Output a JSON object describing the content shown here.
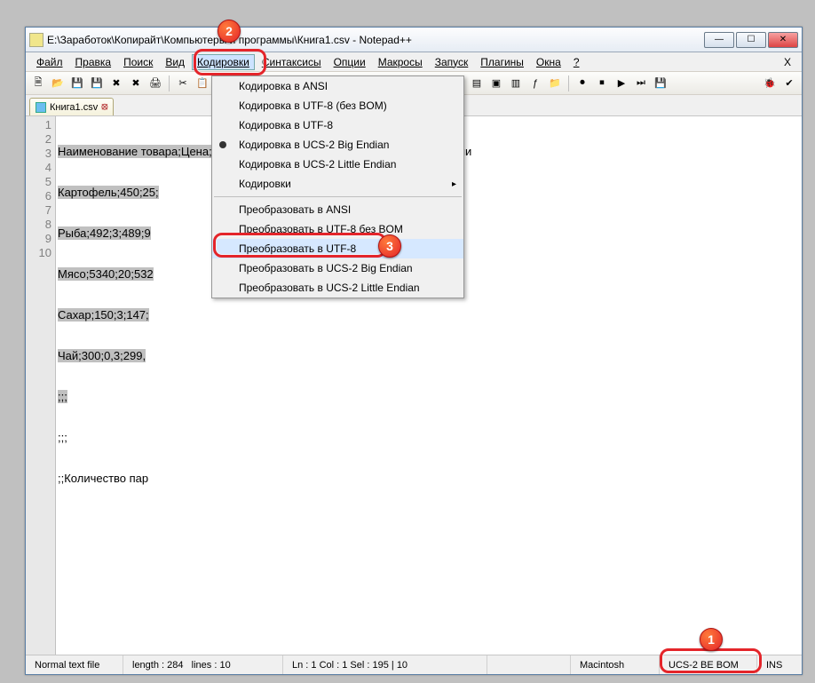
{
  "window": {
    "title": "E:\\Заработок\\Копирайт\\Компьютеры и программы\\Книга1.csv - Notepad++"
  },
  "menu": {
    "file": "Файл",
    "edit": "Правка",
    "search": "Поиск",
    "view": "Вид",
    "encoding": "Кодировки",
    "syntax": "Синтаксисы",
    "options": "Опции",
    "macros": "Макросы",
    "run": "Запуск",
    "plugins": "Плагины",
    "windows": "Окна",
    "help": "?",
    "x": "X"
  },
  "tab": {
    "label": "Книга1.csv",
    "close": "⦻"
  },
  "code": {
    "lines": [
      "Наименование товара;Цена;;;;;;",
      "Картофель;450;25;",
      "Рыба;492;3;489;9",
      "Мясо;5340;20;532",
      "Сахар;150;3;147;",
      "Чай;300;0,3;299,",
      ";;;",
      ";;;",
      ";;Количество пар",
      ""
    ],
    "line1_tail": "ии"
  },
  "dropdown": {
    "enc_ansi": "Кодировка в ANSI",
    "enc_utf8_nobom": "Кодировка в UTF-8 (без BOM)",
    "enc_utf8": "Кодировка в UTF-8",
    "enc_ucs2_be": "Кодировка в UCS-2 Big Endian",
    "enc_ucs2_le": "Кодировка в UCS-2 Little Endian",
    "encodings_sub": "Кодировки",
    "conv_ansi": "Преобразовать в ANSI",
    "conv_utf8_nobom": "Преобразовать в UTF-8 без BOM",
    "conv_utf8": "Преобразовать в UTF-8",
    "conv_ucs2_be": "Преобразовать в UCS-2 Big Endian",
    "conv_ucs2_le": "Преобразовать в UCS-2 Little Endian"
  },
  "status": {
    "filetype": "Normal text file",
    "length_label": "length : 284",
    "lines_label": "lines : 10",
    "pos": "Ln : 1   Col : 1   Sel : 195 | 10",
    "eol": "Macintosh",
    "encoding": "UCS-2 BE BOM",
    "ins": "INS"
  },
  "badges": {
    "b1": "1",
    "b2": "2",
    "b3": "3"
  }
}
